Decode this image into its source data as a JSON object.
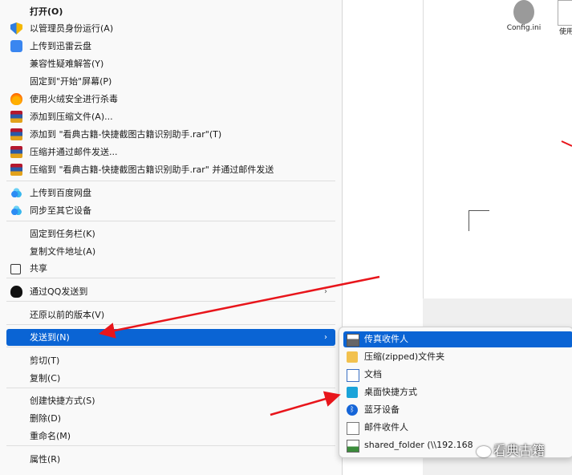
{
  "menu": {
    "items": [
      {
        "label": "打开(O)",
        "icon": "none"
      },
      {
        "label": "以管理员身份运行(A)",
        "icon": "uac-shield-icon"
      },
      {
        "label": "上传到迅雷云盘",
        "icon": "xunlei-icon"
      },
      {
        "label": "兼容性疑难解答(Y)",
        "icon": "none"
      },
      {
        "label": "固定到\"开始\"屏幕(P)",
        "icon": "none"
      },
      {
        "label": "使用火绒安全进行杀毒",
        "icon": "huorong-icon"
      },
      {
        "label": "添加到压缩文件(A)...",
        "icon": "winrar-icon"
      },
      {
        "label": "添加到 \"看典古籍-快捷截图古籍识别助手.rar\"(T)",
        "icon": "winrar-icon"
      },
      {
        "label": "压缩并通过邮件发送...",
        "icon": "winrar-icon"
      },
      {
        "label": "压缩到 \"看典古籍-快捷截图古籍识别助手.rar\" 并通过邮件发送",
        "icon": "winrar-icon"
      },
      {
        "label": "上传到百度网盘",
        "icon": "baidu-netdisk-icon"
      },
      {
        "label": "同步至其它设备",
        "icon": "baidu-netdisk-icon"
      },
      {
        "label": "固定到任务栏(K)",
        "icon": "none"
      },
      {
        "label": "复制文件地址(A)",
        "icon": "none"
      },
      {
        "label": "共享",
        "icon": "share-icon"
      },
      {
        "label": "通过QQ发送到",
        "icon": "qq-icon"
      },
      {
        "label": "还原以前的版本(V)",
        "icon": "none"
      },
      {
        "label": "发送到(N)",
        "icon": "none"
      },
      {
        "label": "剪切(T)",
        "icon": "none"
      },
      {
        "label": "复制(C)",
        "icon": "none"
      },
      {
        "label": "创建快捷方式(S)",
        "icon": "none"
      },
      {
        "label": "删除(D)",
        "icon": "none"
      },
      {
        "label": "重命名(M)",
        "icon": "none"
      },
      {
        "label": "属性(R)",
        "icon": "none"
      }
    ]
  },
  "submenu": {
    "items": [
      {
        "label": "传真收件人",
        "icon": "fax-icon"
      },
      {
        "label": "压缩(zipped)文件夹",
        "icon": "zip-folder-icon"
      },
      {
        "label": "文档",
        "icon": "documents-icon"
      },
      {
        "label": "桌面快捷方式",
        "icon": "desktop-icon"
      },
      {
        "label": "蓝牙设备",
        "icon": "bluetooth-icon"
      },
      {
        "label": "邮件收件人",
        "icon": "mail-icon"
      },
      {
        "label": "shared_folder (\\\\192.168",
        "icon": "network-drive-icon"
      }
    ]
  },
  "background": {
    "file1": "Config.ini",
    "file2": "使用"
  },
  "watermark": "看典古籍",
  "colors": {
    "highlight": "#0a64d4",
    "arrow": "#e8151b"
  }
}
